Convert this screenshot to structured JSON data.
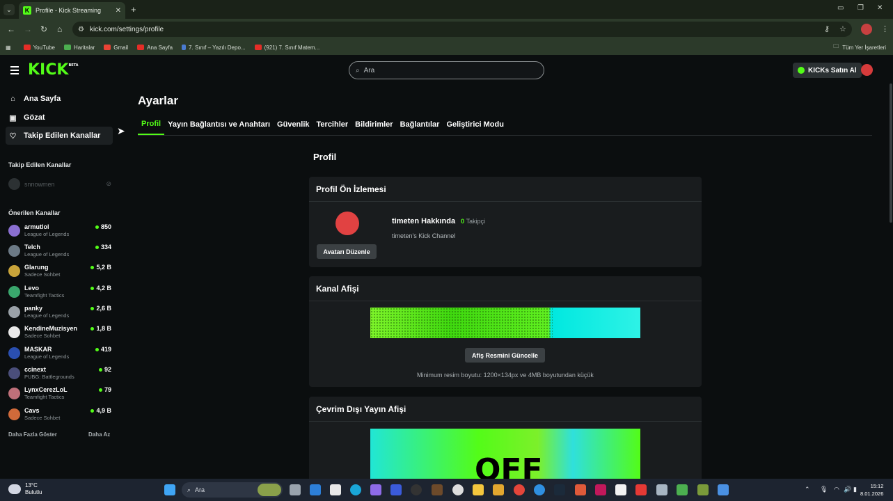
{
  "browser": {
    "tab_title": "Profile - Kick Streaming",
    "tab_favicon": "K",
    "url": "kick.com/settings/profile",
    "bookmarks": [
      {
        "label": "YouTube",
        "color": "#e52d27"
      },
      {
        "label": "Haritalar",
        "color": "#4caf50"
      },
      {
        "label": "Gmail",
        "color": "#ea4335"
      },
      {
        "label": "Ana Sayfa",
        "color": "#e52d27"
      },
      {
        "label": "7. Sınıf – Yazılı Depo...",
        "color": "#4a7bd0"
      },
      {
        "label": "(921) 7. Sınıf Matem...",
        "color": "#e52d27"
      }
    ],
    "all_bookmarks": "Tüm Yer İşaretleri"
  },
  "header": {
    "logo": "KICK",
    "logo_badge": "BETA",
    "search_placeholder": "Ara",
    "buy_button": "KICKs Satın Al"
  },
  "sidebar": {
    "nav": [
      {
        "label": "Ana Sayfa",
        "icon": "home-icon"
      },
      {
        "label": "Gözat",
        "icon": "browse-icon"
      },
      {
        "label": "Takip Edilen Kanallar",
        "icon": "heart-icon"
      }
    ],
    "followed_title": "Takip Edilen Kanallar",
    "followed": [
      {
        "name": "snnowmen",
        "status": "offline"
      }
    ],
    "recommended_title": "Önerilen Kanallar",
    "recommended": [
      {
        "name": "armutlol",
        "category": "League of Legends",
        "viewers": "850",
        "color": "#8a6fd1"
      },
      {
        "name": "Telch",
        "category": "League of Legends",
        "viewers": "334",
        "color": "#6c7a86"
      },
      {
        "name": "Glarung",
        "category": "Sadece Sohbet",
        "viewers": "5,2 B",
        "color": "#c9a43a"
      },
      {
        "name": "Levo",
        "category": "Teamfight Tactics",
        "viewers": "4,2 B",
        "color": "#3aa76d"
      },
      {
        "name": "panky",
        "category": "League of Legends",
        "viewers": "2,6 B",
        "color": "#9aa1a8"
      },
      {
        "name": "KendineMuzisyen",
        "category": "Sadece Sohbet",
        "viewers": "1,8 B",
        "color": "#e9e9e9"
      },
      {
        "name": "MASKAR",
        "category": "League of Legends",
        "viewers": "419",
        "color": "#2a4fb0"
      },
      {
        "name": "ccinext",
        "category": "PUBG: Battlegrounds",
        "viewers": "92",
        "color": "#4a4e7a"
      },
      {
        "name": "LynxCerezLoL",
        "category": "Teamfight Tactics",
        "viewers": "79",
        "color": "#c0707a"
      },
      {
        "name": "Cavs",
        "category": "Sadece Sohbet",
        "viewers": "4,9 B",
        "color": "#d06a3a"
      }
    ],
    "show_more": "Daha Fazla Göster",
    "show_less": "Daha Az"
  },
  "main": {
    "title": "Ayarlar",
    "tabs": [
      "Profil",
      "Yayın Bağlantısı ve Anahtarı",
      "Güvenlik",
      "Tercihler",
      "Bildirimler",
      "Bağlantılar",
      "Geliştirici Modu"
    ],
    "section_title": "Profil",
    "preview": {
      "title": "Profil Ön İzlemesi",
      "edit_avatar": "Avatarı Düzenle",
      "about": "timeten Hakkında",
      "followers_count": "0",
      "followers_label": "Takipçi",
      "description": "timeten's Kick Channel"
    },
    "banner": {
      "title": "Kanal Afişi",
      "update_button": "Afiş Resmini Güncelle",
      "hint": "Minimum resim boyutu: 1200×134px ve 4MB boyutundan küçük"
    },
    "offline": {
      "title": "Çevrim Dışı Yayın Afişi",
      "image_text": "OFF"
    }
  },
  "taskbar": {
    "temperature": "13°C",
    "weather": "Bulutlu",
    "search_placeholder": "Ara",
    "time": "15:12",
    "date": "8.01.2026"
  }
}
